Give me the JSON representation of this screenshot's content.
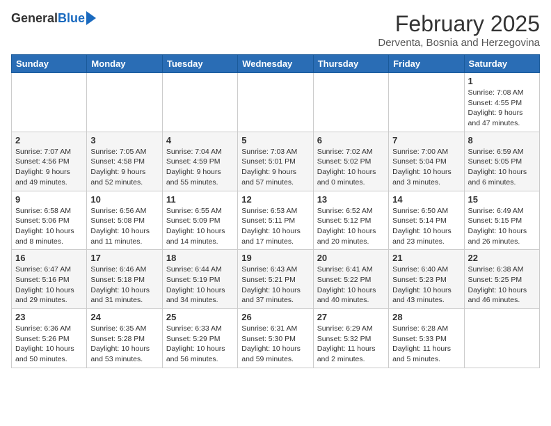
{
  "header": {
    "logo_general": "General",
    "logo_blue": "Blue",
    "month_title": "February 2025",
    "location": "Derventa, Bosnia and Herzegovina"
  },
  "days_of_week": [
    "Sunday",
    "Monday",
    "Tuesday",
    "Wednesday",
    "Thursday",
    "Friday",
    "Saturday"
  ],
  "weeks": [
    [
      {
        "day": "",
        "info": ""
      },
      {
        "day": "",
        "info": ""
      },
      {
        "day": "",
        "info": ""
      },
      {
        "day": "",
        "info": ""
      },
      {
        "day": "",
        "info": ""
      },
      {
        "day": "",
        "info": ""
      },
      {
        "day": "1",
        "info": "Sunrise: 7:08 AM\nSunset: 4:55 PM\nDaylight: 9 hours and 47 minutes."
      }
    ],
    [
      {
        "day": "2",
        "info": "Sunrise: 7:07 AM\nSunset: 4:56 PM\nDaylight: 9 hours and 49 minutes."
      },
      {
        "day": "3",
        "info": "Sunrise: 7:05 AM\nSunset: 4:58 PM\nDaylight: 9 hours and 52 minutes."
      },
      {
        "day": "4",
        "info": "Sunrise: 7:04 AM\nSunset: 4:59 PM\nDaylight: 9 hours and 55 minutes."
      },
      {
        "day": "5",
        "info": "Sunrise: 7:03 AM\nSunset: 5:01 PM\nDaylight: 9 hours and 57 minutes."
      },
      {
        "day": "6",
        "info": "Sunrise: 7:02 AM\nSunset: 5:02 PM\nDaylight: 10 hours and 0 minutes."
      },
      {
        "day": "7",
        "info": "Sunrise: 7:00 AM\nSunset: 5:04 PM\nDaylight: 10 hours and 3 minutes."
      },
      {
        "day": "8",
        "info": "Sunrise: 6:59 AM\nSunset: 5:05 PM\nDaylight: 10 hours and 6 minutes."
      }
    ],
    [
      {
        "day": "9",
        "info": "Sunrise: 6:58 AM\nSunset: 5:06 PM\nDaylight: 10 hours and 8 minutes."
      },
      {
        "day": "10",
        "info": "Sunrise: 6:56 AM\nSunset: 5:08 PM\nDaylight: 10 hours and 11 minutes."
      },
      {
        "day": "11",
        "info": "Sunrise: 6:55 AM\nSunset: 5:09 PM\nDaylight: 10 hours and 14 minutes."
      },
      {
        "day": "12",
        "info": "Sunrise: 6:53 AM\nSunset: 5:11 PM\nDaylight: 10 hours and 17 minutes."
      },
      {
        "day": "13",
        "info": "Sunrise: 6:52 AM\nSunset: 5:12 PM\nDaylight: 10 hours and 20 minutes."
      },
      {
        "day": "14",
        "info": "Sunrise: 6:50 AM\nSunset: 5:14 PM\nDaylight: 10 hours and 23 minutes."
      },
      {
        "day": "15",
        "info": "Sunrise: 6:49 AM\nSunset: 5:15 PM\nDaylight: 10 hours and 26 minutes."
      }
    ],
    [
      {
        "day": "16",
        "info": "Sunrise: 6:47 AM\nSunset: 5:16 PM\nDaylight: 10 hours and 29 minutes."
      },
      {
        "day": "17",
        "info": "Sunrise: 6:46 AM\nSunset: 5:18 PM\nDaylight: 10 hours and 31 minutes."
      },
      {
        "day": "18",
        "info": "Sunrise: 6:44 AM\nSunset: 5:19 PM\nDaylight: 10 hours and 34 minutes."
      },
      {
        "day": "19",
        "info": "Sunrise: 6:43 AM\nSunset: 5:21 PM\nDaylight: 10 hours and 37 minutes."
      },
      {
        "day": "20",
        "info": "Sunrise: 6:41 AM\nSunset: 5:22 PM\nDaylight: 10 hours and 40 minutes."
      },
      {
        "day": "21",
        "info": "Sunrise: 6:40 AM\nSunset: 5:23 PM\nDaylight: 10 hours and 43 minutes."
      },
      {
        "day": "22",
        "info": "Sunrise: 6:38 AM\nSunset: 5:25 PM\nDaylight: 10 hours and 46 minutes."
      }
    ],
    [
      {
        "day": "23",
        "info": "Sunrise: 6:36 AM\nSunset: 5:26 PM\nDaylight: 10 hours and 50 minutes."
      },
      {
        "day": "24",
        "info": "Sunrise: 6:35 AM\nSunset: 5:28 PM\nDaylight: 10 hours and 53 minutes."
      },
      {
        "day": "25",
        "info": "Sunrise: 6:33 AM\nSunset: 5:29 PM\nDaylight: 10 hours and 56 minutes."
      },
      {
        "day": "26",
        "info": "Sunrise: 6:31 AM\nSunset: 5:30 PM\nDaylight: 10 hours and 59 minutes."
      },
      {
        "day": "27",
        "info": "Sunrise: 6:29 AM\nSunset: 5:32 PM\nDaylight: 11 hours and 2 minutes."
      },
      {
        "day": "28",
        "info": "Sunrise: 6:28 AM\nSunset: 5:33 PM\nDaylight: 11 hours and 5 minutes."
      },
      {
        "day": "",
        "info": ""
      }
    ]
  ]
}
